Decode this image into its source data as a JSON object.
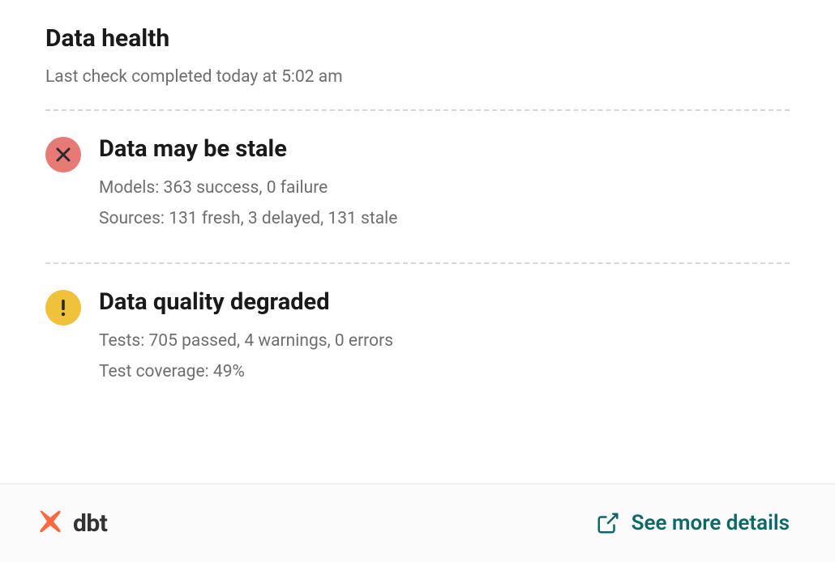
{
  "header": {
    "title": "Data health",
    "last_check": "Last check completed today at 5:02 am"
  },
  "sections": {
    "freshness": {
      "status": "error",
      "title": "Data may be stale",
      "models_line": "Models: 363 success, 0 failure",
      "sources_line": "Sources: 131 fresh, 3 delayed, 131 stale"
    },
    "quality": {
      "status": "warning",
      "title": "Data quality degraded",
      "tests_line": "Tests: 705 passed, 4 warnings, 0 errors",
      "coverage_line": "Test coverage: 49%"
    }
  },
  "footer": {
    "brand": "dbt",
    "link_label": "See more details"
  },
  "colors": {
    "error": "#e77a76",
    "warning": "#f0c23b",
    "accent": "#0d6866",
    "brand": "#ff6941"
  }
}
